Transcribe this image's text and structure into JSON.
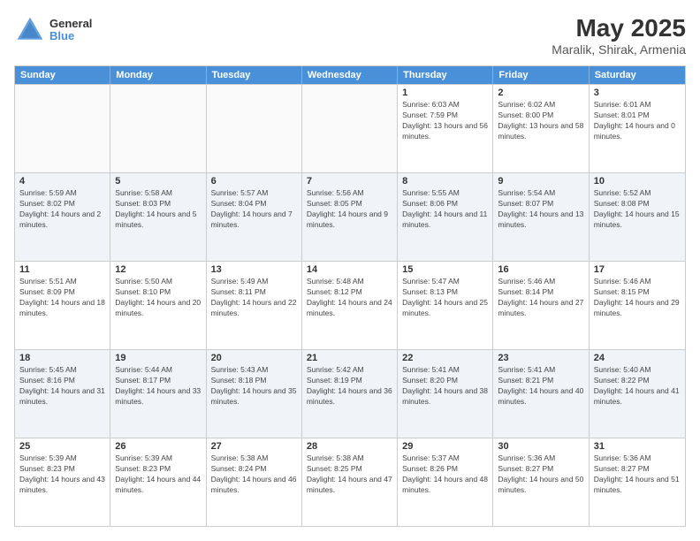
{
  "header": {
    "logo_line1": "General",
    "logo_line2": "Blue",
    "title": "May 2025",
    "subtitle": "Maralik, Shirak, Armenia"
  },
  "days_of_week": [
    "Sunday",
    "Monday",
    "Tuesday",
    "Wednesday",
    "Thursday",
    "Friday",
    "Saturday"
  ],
  "weeks": [
    [
      {
        "day": "",
        "empty": true
      },
      {
        "day": "",
        "empty": true
      },
      {
        "day": "",
        "empty": true
      },
      {
        "day": "",
        "empty": true
      },
      {
        "day": "1",
        "sunrise": "6:03 AM",
        "sunset": "7:59 PM",
        "daylight": "13 hours and 56 minutes."
      },
      {
        "day": "2",
        "sunrise": "6:02 AM",
        "sunset": "8:00 PM",
        "daylight": "13 hours and 58 minutes."
      },
      {
        "day": "3",
        "sunrise": "6:01 AM",
        "sunset": "8:01 PM",
        "daylight": "14 hours and 0 minutes."
      }
    ],
    [
      {
        "day": "4",
        "sunrise": "5:59 AM",
        "sunset": "8:02 PM",
        "daylight": "14 hours and 2 minutes."
      },
      {
        "day": "5",
        "sunrise": "5:58 AM",
        "sunset": "8:03 PM",
        "daylight": "14 hours and 5 minutes."
      },
      {
        "day": "6",
        "sunrise": "5:57 AM",
        "sunset": "8:04 PM",
        "daylight": "14 hours and 7 minutes."
      },
      {
        "day": "7",
        "sunrise": "5:56 AM",
        "sunset": "8:05 PM",
        "daylight": "14 hours and 9 minutes."
      },
      {
        "day": "8",
        "sunrise": "5:55 AM",
        "sunset": "8:06 PM",
        "daylight": "14 hours and 11 minutes."
      },
      {
        "day": "9",
        "sunrise": "5:54 AM",
        "sunset": "8:07 PM",
        "daylight": "14 hours and 13 minutes."
      },
      {
        "day": "10",
        "sunrise": "5:52 AM",
        "sunset": "8:08 PM",
        "daylight": "14 hours and 15 minutes."
      }
    ],
    [
      {
        "day": "11",
        "sunrise": "5:51 AM",
        "sunset": "8:09 PM",
        "daylight": "14 hours and 18 minutes."
      },
      {
        "day": "12",
        "sunrise": "5:50 AM",
        "sunset": "8:10 PM",
        "daylight": "14 hours and 20 minutes."
      },
      {
        "day": "13",
        "sunrise": "5:49 AM",
        "sunset": "8:11 PM",
        "daylight": "14 hours and 22 minutes."
      },
      {
        "day": "14",
        "sunrise": "5:48 AM",
        "sunset": "8:12 PM",
        "daylight": "14 hours and 24 minutes."
      },
      {
        "day": "15",
        "sunrise": "5:47 AM",
        "sunset": "8:13 PM",
        "daylight": "14 hours and 25 minutes."
      },
      {
        "day": "16",
        "sunrise": "5:46 AM",
        "sunset": "8:14 PM",
        "daylight": "14 hours and 27 minutes."
      },
      {
        "day": "17",
        "sunrise": "5:46 AM",
        "sunset": "8:15 PM",
        "daylight": "14 hours and 29 minutes."
      }
    ],
    [
      {
        "day": "18",
        "sunrise": "5:45 AM",
        "sunset": "8:16 PM",
        "daylight": "14 hours and 31 minutes."
      },
      {
        "day": "19",
        "sunrise": "5:44 AM",
        "sunset": "8:17 PM",
        "daylight": "14 hours and 33 minutes."
      },
      {
        "day": "20",
        "sunrise": "5:43 AM",
        "sunset": "8:18 PM",
        "daylight": "14 hours and 35 minutes."
      },
      {
        "day": "21",
        "sunrise": "5:42 AM",
        "sunset": "8:19 PM",
        "daylight": "14 hours and 36 minutes."
      },
      {
        "day": "22",
        "sunrise": "5:41 AM",
        "sunset": "8:20 PM",
        "daylight": "14 hours and 38 minutes."
      },
      {
        "day": "23",
        "sunrise": "5:41 AM",
        "sunset": "8:21 PM",
        "daylight": "14 hours and 40 minutes."
      },
      {
        "day": "24",
        "sunrise": "5:40 AM",
        "sunset": "8:22 PM",
        "daylight": "14 hours and 41 minutes."
      }
    ],
    [
      {
        "day": "25",
        "sunrise": "5:39 AM",
        "sunset": "8:23 PM",
        "daylight": "14 hours and 43 minutes."
      },
      {
        "day": "26",
        "sunrise": "5:39 AM",
        "sunset": "8:23 PM",
        "daylight": "14 hours and 44 minutes."
      },
      {
        "day": "27",
        "sunrise": "5:38 AM",
        "sunset": "8:24 PM",
        "daylight": "14 hours and 46 minutes."
      },
      {
        "day": "28",
        "sunrise": "5:38 AM",
        "sunset": "8:25 PM",
        "daylight": "14 hours and 47 minutes."
      },
      {
        "day": "29",
        "sunrise": "5:37 AM",
        "sunset": "8:26 PM",
        "daylight": "14 hours and 48 minutes."
      },
      {
        "day": "30",
        "sunrise": "5:36 AM",
        "sunset": "8:27 PM",
        "daylight": "14 hours and 50 minutes."
      },
      {
        "day": "31",
        "sunrise": "5:36 AM",
        "sunset": "8:27 PM",
        "daylight": "14 hours and 51 minutes."
      }
    ]
  ]
}
